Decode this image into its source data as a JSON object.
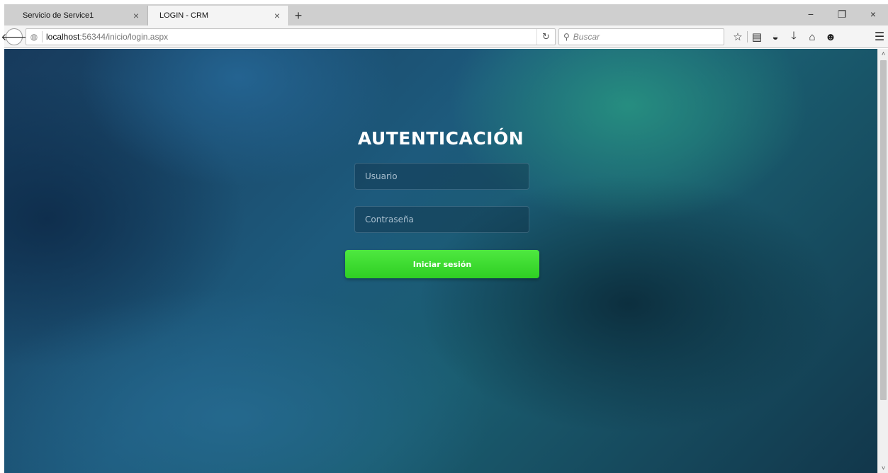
{
  "tabs": [
    {
      "label": "Servicio de Service1",
      "close": "×"
    },
    {
      "label": "LOGIN - CRM",
      "close": "×"
    }
  ],
  "new_tab": "+",
  "window_controls": {
    "minimize": "−",
    "restore": "❐",
    "close": "×"
  },
  "address": {
    "host": "localhost",
    "path": ":56344/inicio/login.aspx"
  },
  "search": {
    "placeholder": "Buscar"
  },
  "page": {
    "title": "AUTENTICACIÓN",
    "username_placeholder": "Usuario",
    "password_placeholder": "Contraseña",
    "login_label": "Iniciar sesión"
  },
  "colors": {
    "login_button": "#3ddc30",
    "background": "#1b4f6e"
  },
  "icons": [
    "back-arrow-icon",
    "globe-icon",
    "reload-icon",
    "search-icon",
    "bookmark-star-icon",
    "reading-list-icon",
    "pocket-icon",
    "download-icon",
    "home-icon",
    "chat-icon",
    "menu-icon"
  ]
}
